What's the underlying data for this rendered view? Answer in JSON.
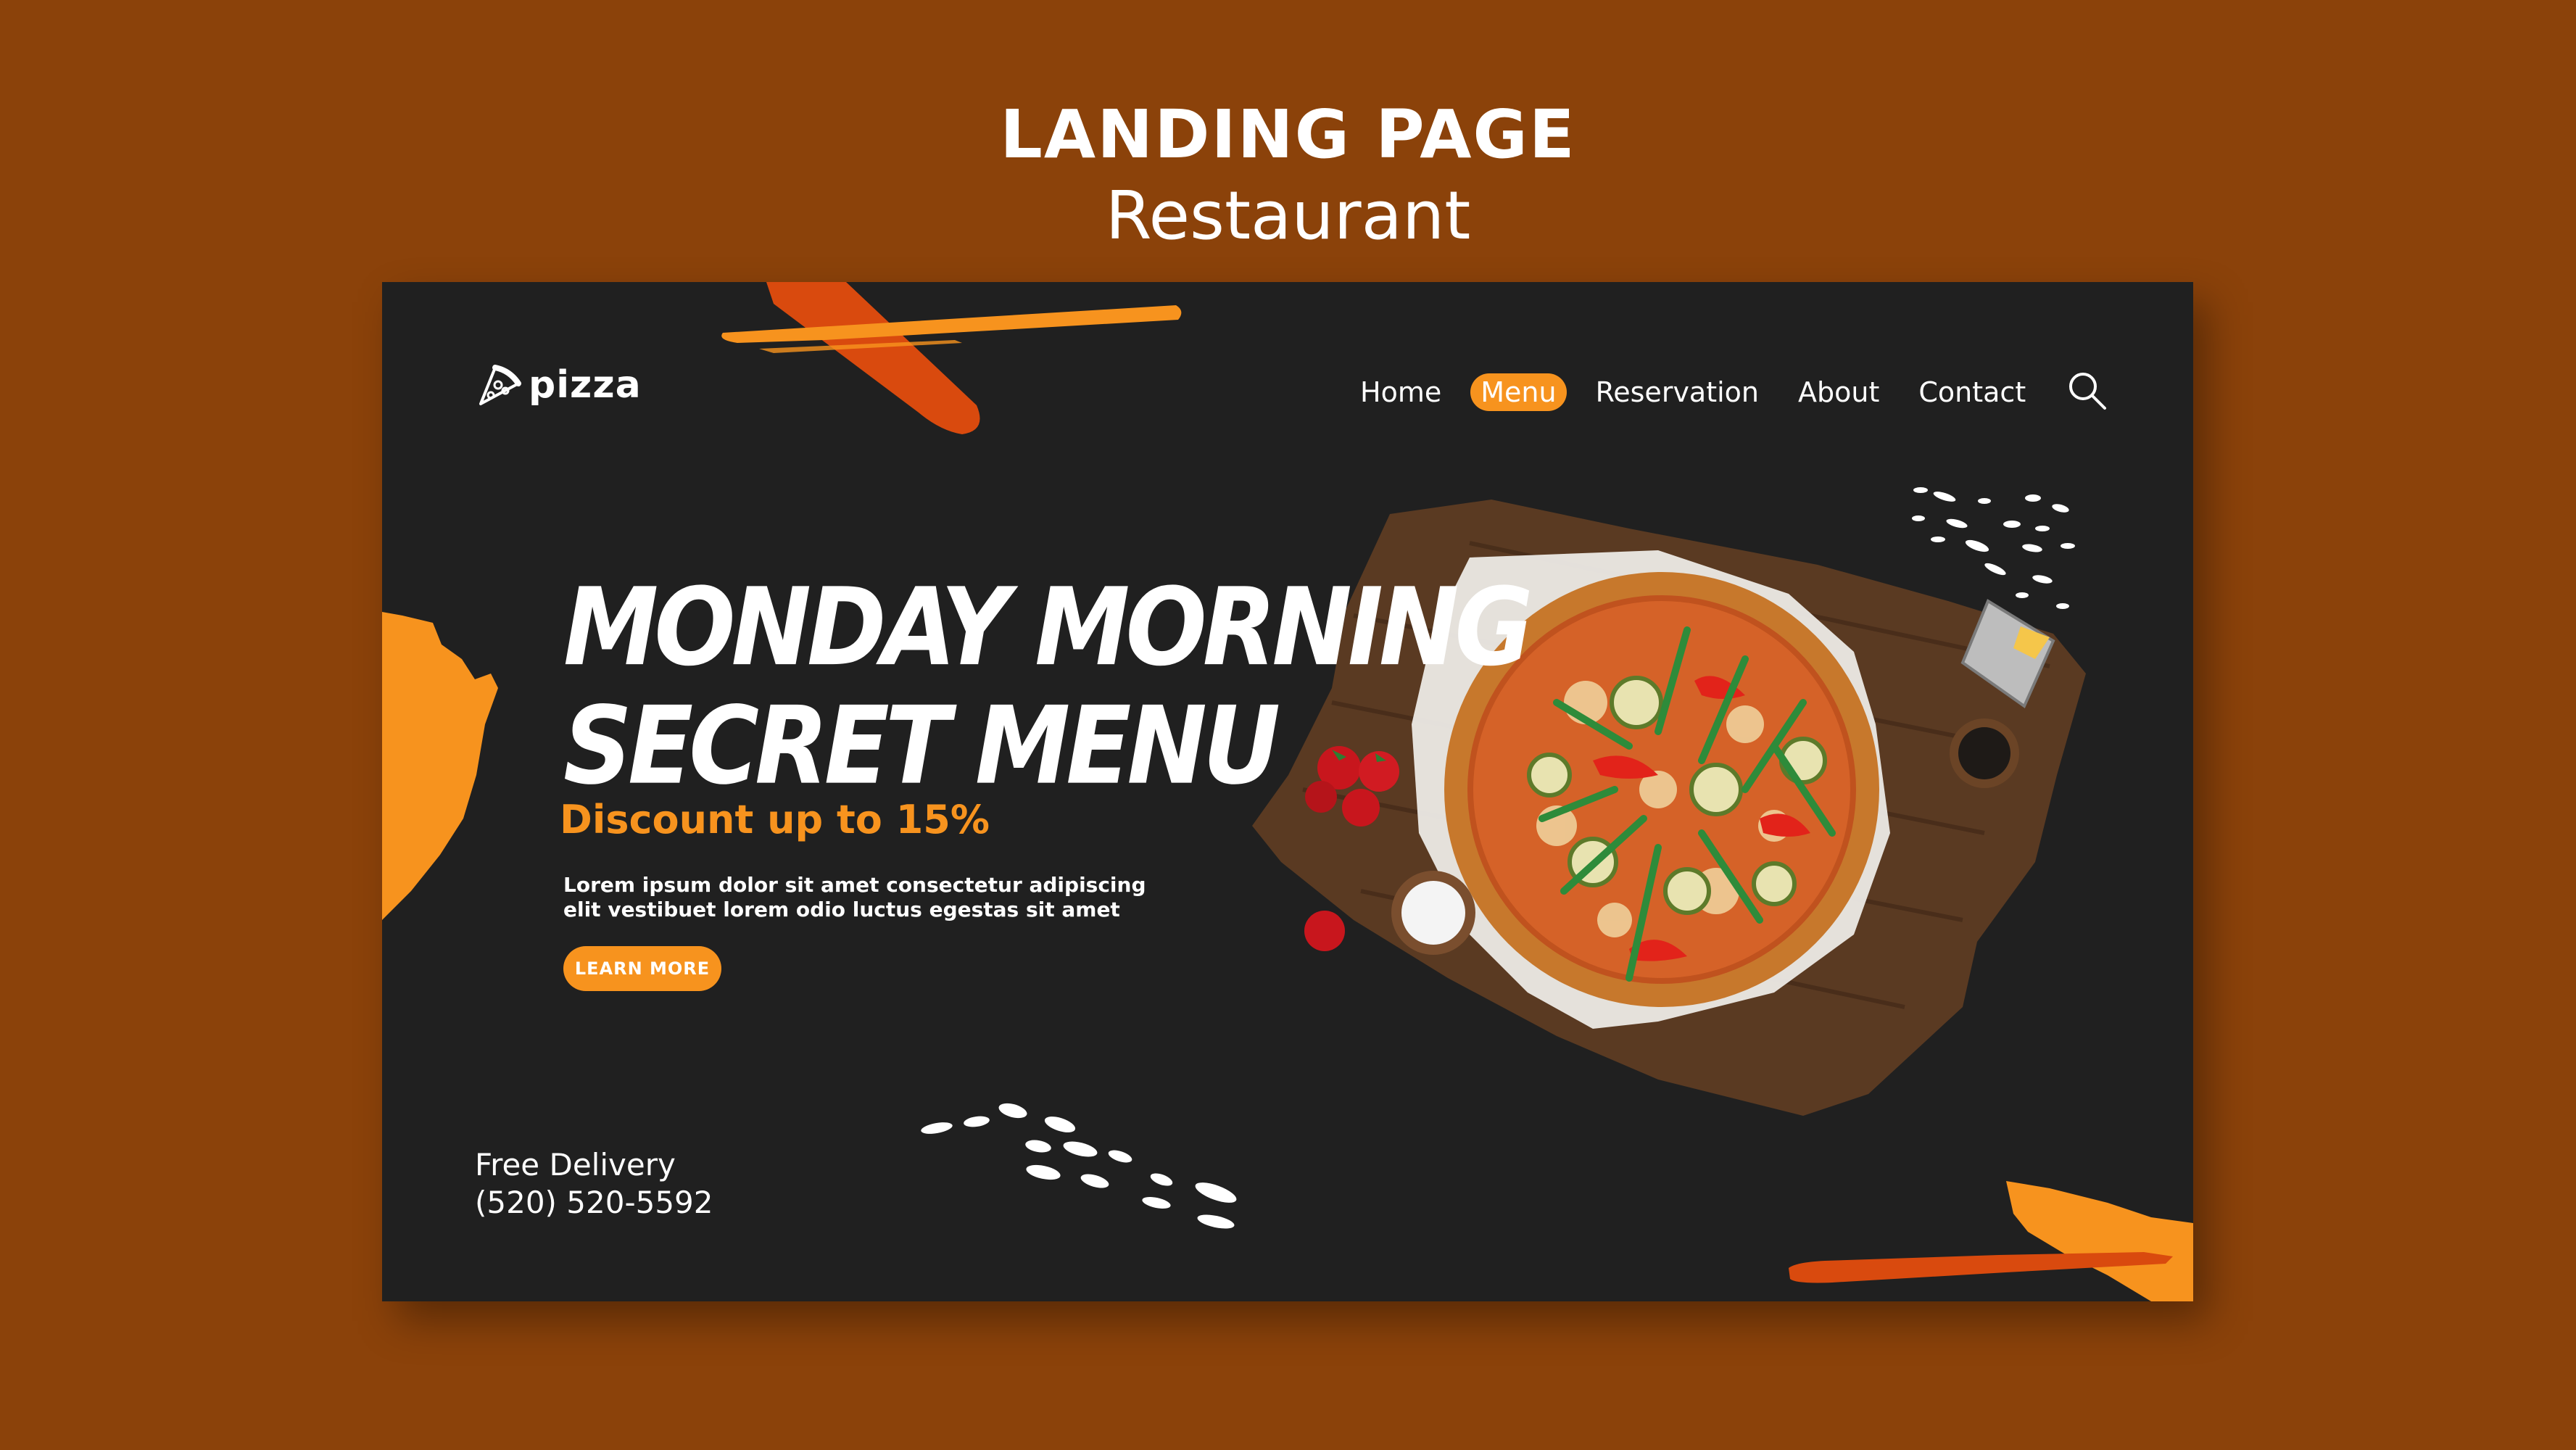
{
  "heading": {
    "title": "LANDING PAGE",
    "subtitle": "Restaurant"
  },
  "brand": {
    "logo_text": "pizza",
    "logo_icon": "pizza-slice-icon"
  },
  "nav": {
    "items": [
      {
        "label": "Home",
        "active": false
      },
      {
        "label": "Menu",
        "active": true
      },
      {
        "label": "Reservation",
        "active": false
      },
      {
        "label": "About",
        "active": false
      },
      {
        "label": "Contact",
        "active": false
      }
    ],
    "search_icon": "search-icon"
  },
  "hero": {
    "title_line1": "MONDAY MORNING",
    "title_line2": "SECRET MENU",
    "discount": "Discount up to 15%",
    "body_line1": "Lorem ipsum dolor sit amet consectetur adipiscing",
    "body_line2": "elit vestibuet lorem odio luctus egestas sit amet",
    "cta_label": "LEARN MORE"
  },
  "footer": {
    "delivery_label": "Free Delivery",
    "phone": "(520) 520-5592"
  },
  "colors": {
    "background": "#8B420A",
    "panel": "#202020",
    "accent": "#F7931E",
    "accent_dark": "#D94A0E",
    "text": "#FFFFFF"
  }
}
